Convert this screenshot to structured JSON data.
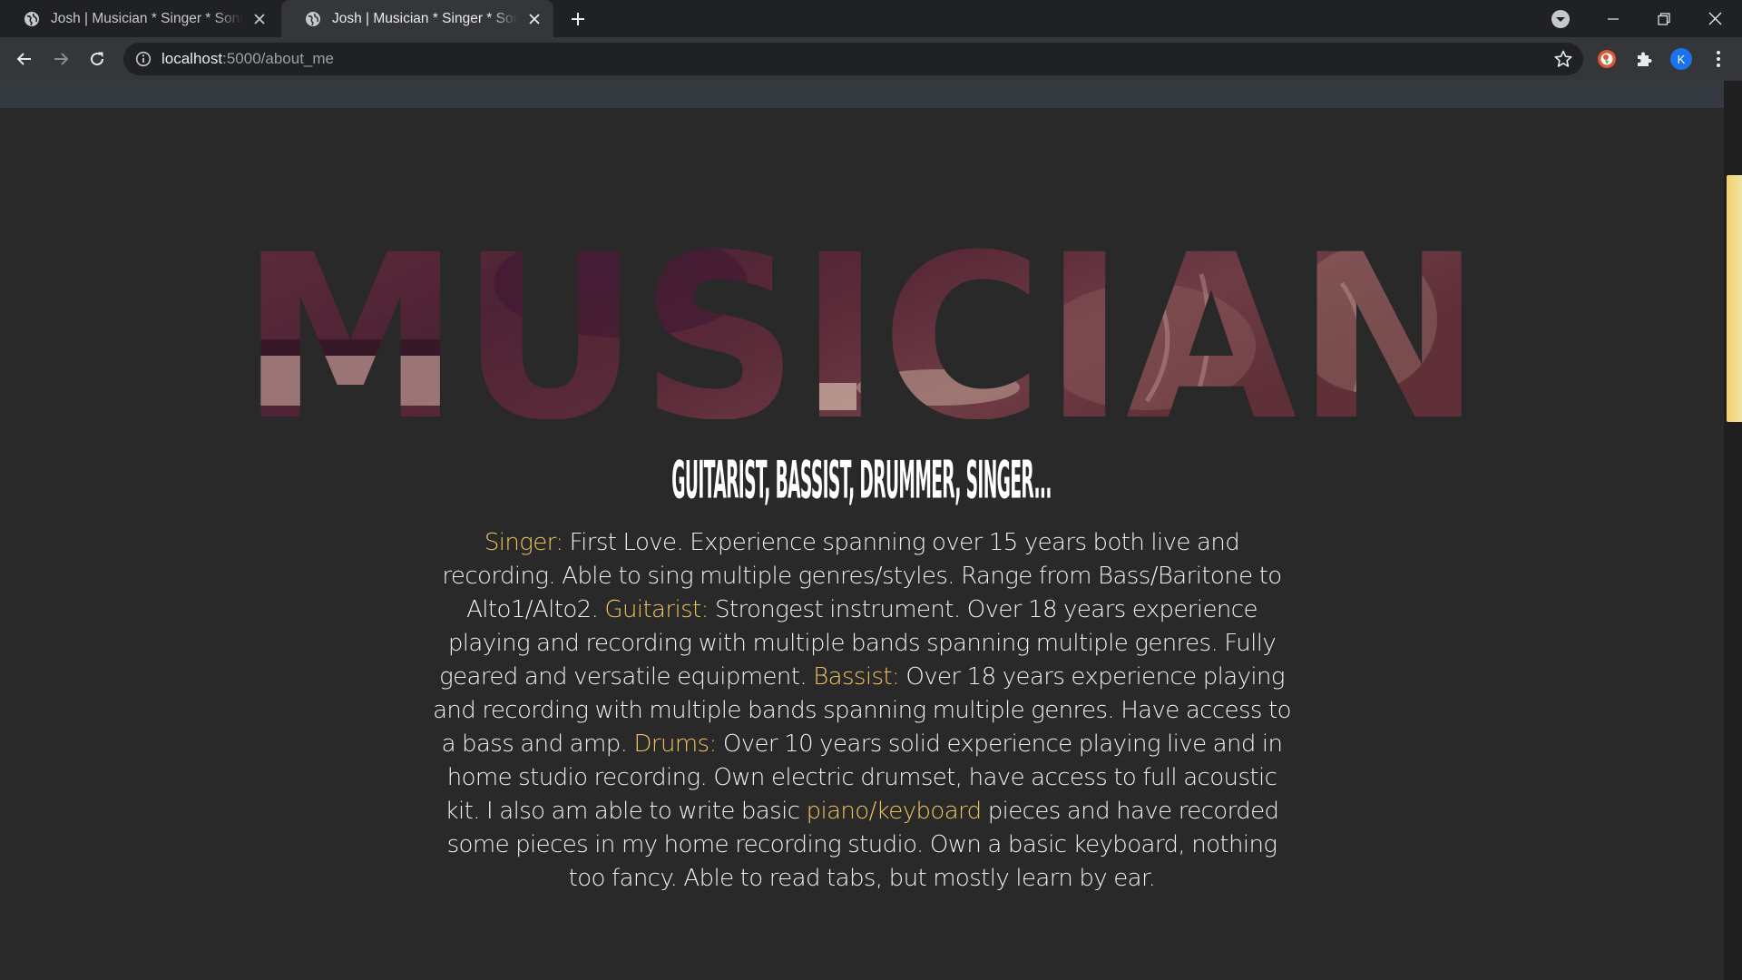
{
  "browser": {
    "tabs": [
      {
        "title": "Josh | Musician * Singer * Songwriter",
        "active": false
      },
      {
        "title": "Josh | Musician * Singer * Songwriter",
        "active": true
      }
    ],
    "address": {
      "host": "localhost",
      "path": ":5000/about_me"
    },
    "profile_initial": "K",
    "icons": [
      "globe-icon",
      "close-icon",
      "plus-icon",
      "tab-search-icon",
      "minimize-icon",
      "restore-icon",
      "close-window-icon",
      "back-icon",
      "forward-icon",
      "reload-icon",
      "info-icon",
      "star-icon",
      "duckduckgo-icon",
      "extensions-puzzle-icon",
      "more-vert-icon"
    ]
  },
  "page": {
    "hero_word": "MUSICIAN",
    "subtitle": "Guitarist, Bassist, Drummer, Singer...",
    "bio": [
      {
        "t": "Singer:",
        "hl": true
      },
      {
        "t": " First Love. Experience spanning over 15 years both live and recording. Able to sing multiple genres/styles. Range from Bass/Baritone to Alto1/Alto2. ",
        "hl": false
      },
      {
        "t": "Guitarist:",
        "hl": true
      },
      {
        "t": " Strongest instrument. Over 18 years experience playing and recording with multiple bands spanning multiple genres. Fully geared and versatile equipment. ",
        "hl": false
      },
      {
        "t": "Bassist:",
        "hl": true
      },
      {
        "t": " Over 18 years experience playing and recording with multiple bands spanning multiple genres. Have access to a bass and amp. ",
        "hl": false
      },
      {
        "t": "Drums:",
        "hl": true
      },
      {
        "t": " Over 10 years solid experience playing live and in home studio recording. Own electric drumset, have access to full acoustic kit. I also am able to write basic ",
        "hl": false
      },
      {
        "t": "piano/keyboard",
        "hl": true
      },
      {
        "t": " pieces and have recorded some pieces in my home recording studio. Own a basic keyboard, nothing too fancy. Able to read tabs, but mostly learn by ear.",
        "hl": false
      }
    ]
  },
  "colors": {
    "page_bg": "#292929",
    "highlight": "#efc25e",
    "hero_tone": "#5a2a36",
    "scroll_thumb": "#f4d06b"
  },
  "scroll_position": 0.1
}
